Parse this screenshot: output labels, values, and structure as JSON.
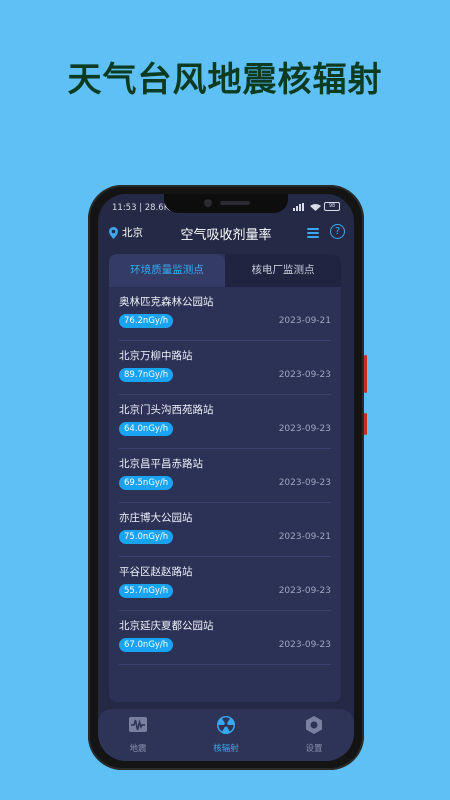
{
  "headline": "天气台风地震核辐射",
  "status": {
    "left": "11:53 | 28.6K/",
    "battery": "98"
  },
  "appbar": {
    "location": "北京",
    "title": "空气吸收剂量率"
  },
  "tabs": [
    {
      "label": "环境质量监测点",
      "active": true
    },
    {
      "label": "核电厂监测点",
      "active": false
    }
  ],
  "stations": [
    {
      "name": "奥林匹克森林公园站",
      "value": "76.2nGy/h",
      "date": "2023-09-21"
    },
    {
      "name": "北京万柳中路站",
      "value": "89.7nGy/h",
      "date": "2023-09-23"
    },
    {
      "name": "北京门头沟西苑路站",
      "value": "64.0nGy/h",
      "date": "2023-09-23"
    },
    {
      "name": "北京昌平昌赤路站",
      "value": "69.5nGy/h",
      "date": "2023-09-23"
    },
    {
      "name": "亦庄博大公园站",
      "value": "75.0nGy/h",
      "date": "2023-09-21"
    },
    {
      "name": "平谷区赵赵路站",
      "value": "55.7nGy/h",
      "date": "2023-09-23"
    },
    {
      "name": "北京延庆夏都公园站",
      "value": "67.0nGy/h",
      "date": "2023-09-23"
    }
  ],
  "nav": [
    {
      "label": "地震",
      "icon": "seismic-icon",
      "active": false
    },
    {
      "label": "核辐射",
      "icon": "radiation-icon",
      "active": true
    },
    {
      "label": "设置",
      "icon": "gear-icon",
      "active": false
    }
  ],
  "colors": {
    "accent": "#35aaf2",
    "background": "#5ec0f5",
    "screen": "#242a46"
  }
}
